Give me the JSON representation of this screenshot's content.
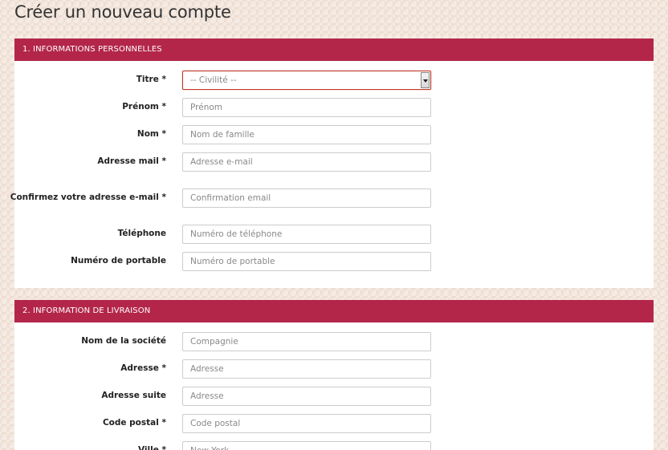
{
  "page": {
    "title": "Créer un nouveau compte"
  },
  "section1": {
    "header": "1. INFORMATIONS PERSONNELLES",
    "title_label": "Titre *",
    "title_value": "-- Civilité --",
    "firstname_label": "Prénom *",
    "firstname_placeholder": "Prénom",
    "lastname_label": "Nom *",
    "lastname_placeholder": "Nom de famille",
    "email_label": "Adresse mail *",
    "email_placeholder": "Adresse e-mail",
    "email_confirm_label": "Confirmez votre adresse e-mail *",
    "email_confirm_placeholder": "Confirmation email",
    "phone_label": "Téléphone",
    "phone_placeholder": "Numéro de téléphone",
    "mobile_label": "Numéro de portable",
    "mobile_placeholder": "Numéro de portable"
  },
  "section2": {
    "header": "2. INFORMATION DE LIVRAISON",
    "company_label": "Nom de la société",
    "company_placeholder": "Compagnie",
    "address_label": "Adresse *",
    "address_placeholder": "Adresse",
    "address2_label": "Adresse suite",
    "address2_placeholder": "Adresse",
    "postal_label": "Code postal *",
    "postal_placeholder": "Code postal",
    "city_label": "Ville *",
    "city_placeholder": "New York"
  },
  "colors": {
    "accent": "#b3264a",
    "background": "#f5ebe3"
  },
  "icons": {
    "select_arrow": "chevron-down-icon"
  }
}
